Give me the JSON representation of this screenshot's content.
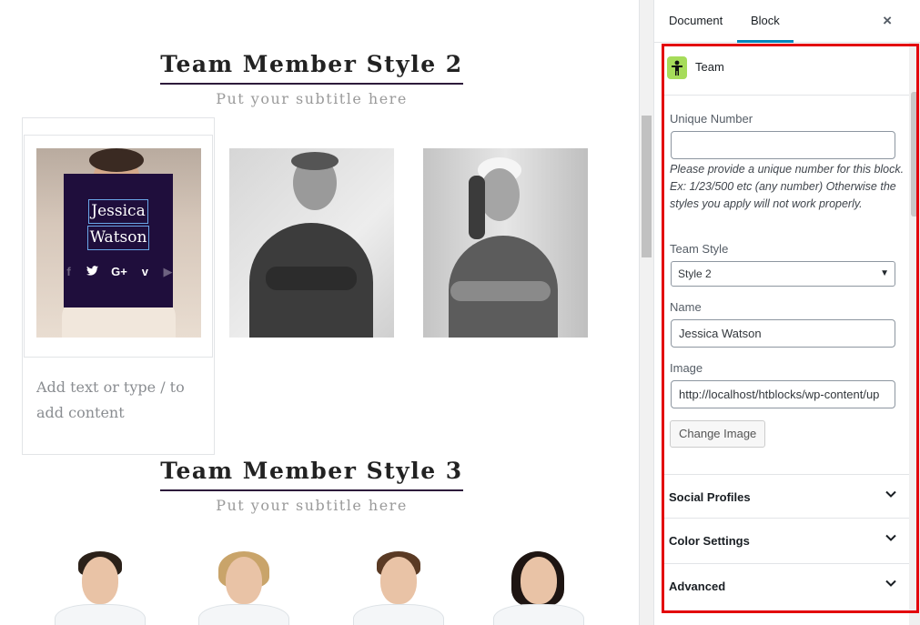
{
  "editor": {
    "style2": {
      "title": "Team Member Style 2",
      "subtitle": "Put your subtitle here",
      "selected_member": {
        "name_line1": "Jessica",
        "name_line2": "Watson",
        "social_icons": [
          "facebook-icon",
          "twitter-icon",
          "google-plus-icon",
          "vimeo-icon",
          "youtube-icon"
        ]
      }
    },
    "placeholder": "Add text or type / to add content",
    "style3": {
      "title": "Team Member Style 3",
      "subtitle": "Put your subtitle here"
    }
  },
  "sidebar": {
    "tabs": [
      "Document",
      "Block"
    ],
    "active_tab": "Block",
    "close_label": "×",
    "block_name": "Team",
    "fields": {
      "unique_number": {
        "label": "Unique Number",
        "value": "",
        "help": "Please provide a unique number for this block. Ex: 1/23/500 etc (any number) Otherwise the styles you apply will not work properly."
      },
      "team_style": {
        "label": "Team Style",
        "value": "Style 2"
      },
      "name": {
        "label": "Name",
        "value": "Jessica Watson"
      },
      "image": {
        "label": "Image",
        "value": "http://localhost/htblocks/wp-content/up"
      },
      "change_image_label": "Change Image"
    },
    "sections": [
      "Social Profiles",
      "Color Settings",
      "Advanced"
    ]
  },
  "colors": {
    "accent": "#0085ba",
    "highlight_frame": "#e3000b",
    "overlay": "#1f0e3c",
    "block_icon_bg": "#a6dc5a"
  }
}
